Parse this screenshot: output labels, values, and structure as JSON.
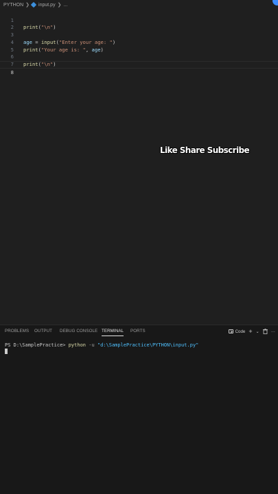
{
  "breadcrumb": {
    "folder": "PYTHON",
    "file": "input.py",
    "more": "..."
  },
  "editor": {
    "lines": [
      {
        "num": "1"
      },
      {
        "num": "2"
      },
      {
        "num": "3"
      },
      {
        "num": "4"
      },
      {
        "num": "5"
      },
      {
        "num": "6"
      },
      {
        "num": "7"
      },
      {
        "num": "8"
      }
    ],
    "code": {
      "l1_fn": "print",
      "l1_open": "(",
      "l1_str": "\"\\n\"",
      "l1_close": ")",
      "l3_var": "age",
      "l3_eq": " = ",
      "l3_fn": "input",
      "l3_open": "(",
      "l3_str": "\"Enter your age: \"",
      "l3_close": ")",
      "l4_fn": "print",
      "l4_open": "(",
      "l4_str": "\"Your age is: \"",
      "l4_comma": ", ",
      "l4_var": "age",
      "l4_close": ")",
      "l6_fn": "print",
      "l6_open": "(",
      "l6_str": "\"\\n\"",
      "l6_close": ")"
    }
  },
  "overlay_text": "Like Share Subscribe",
  "panel": {
    "tabs": [
      "PROBLEMS",
      "OUTPUT",
      "DEBUG CONSOLE",
      "TERMINAL",
      "PORTS"
    ],
    "active_tab": "TERMINAL",
    "terminal_profile": "Code",
    "add_icon": "+",
    "dropdown_icon": "⌄",
    "more_icon": "···"
  },
  "terminal": {
    "prompt": "PS D:\\SamplePractice> ",
    "command": "python",
    "flag": " -u ",
    "path": "\"d:\\SamplePractice\\PYTHON\\input.py\""
  },
  "colors": {
    "background": "#1f1f1f",
    "panel_background": "#181818",
    "accent": "#3c8fdc"
  }
}
